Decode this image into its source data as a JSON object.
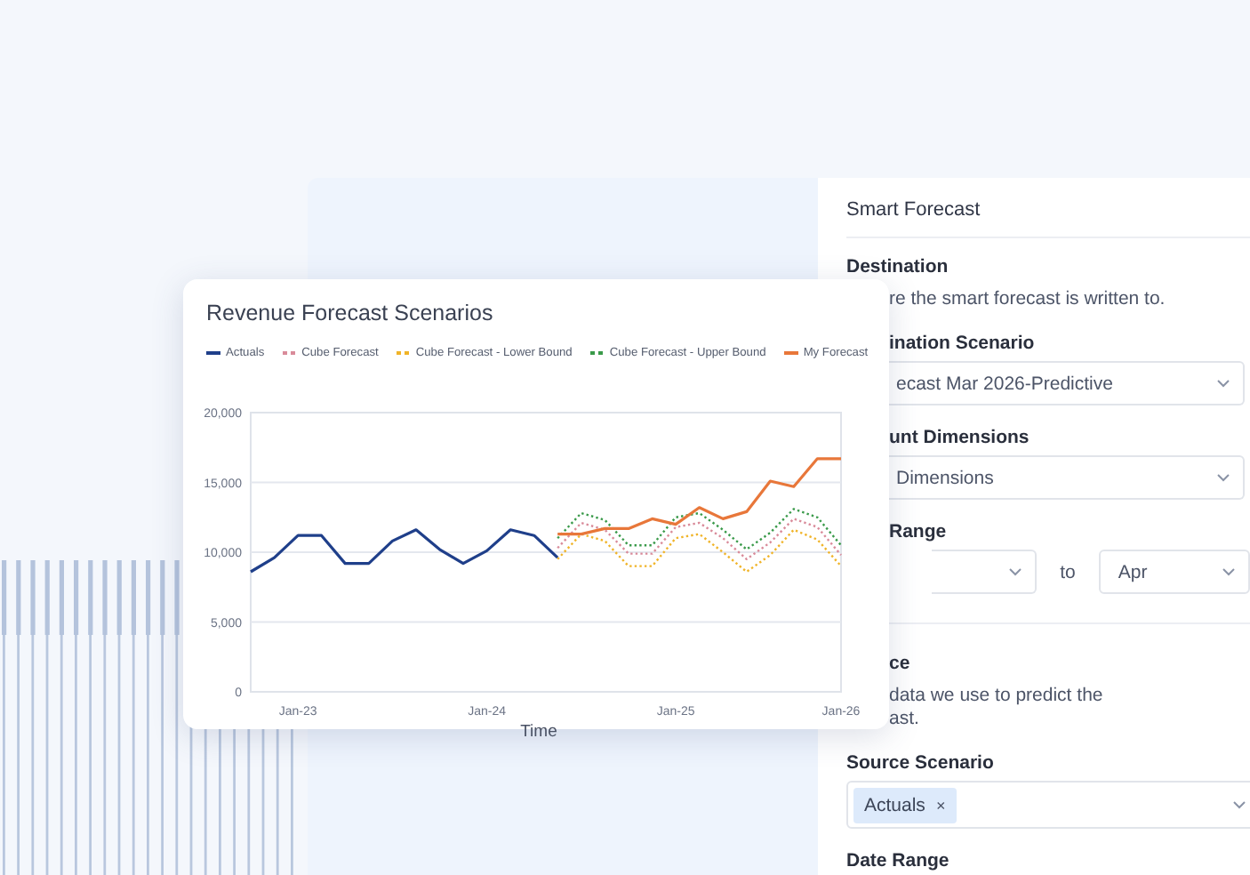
{
  "chart_card": {
    "title": "Revenue Forecast Scenarios",
    "chart_data": {
      "type": "line",
      "xlabel": "Time",
      "categories": [
        null,
        null,
        "Jan-23",
        null,
        null,
        null,
        null,
        null,
        null,
        null,
        "Jan-24",
        null,
        null,
        null,
        null,
        null,
        null,
        null,
        "Jan-25",
        null,
        null,
        null,
        null,
        null,
        null,
        "Jan-26"
      ],
      "ylim": [
        0,
        20000
      ],
      "grid": true,
      "yticks": [
        0,
        {
          "value": 5000,
          "label": "5,000"
        },
        {
          "value": 10000,
          "label": "10,000"
        },
        {
          "value": 15000,
          "label": "15,000"
        },
        {
          "value": 20000,
          "label": "20,000"
        }
      ],
      "series": [
        {
          "name": "Actuals",
          "color": "#1f3f8a",
          "values": [
            8600,
            9600,
            11200,
            11200,
            9200,
            9200,
            10800,
            11600,
            10200,
            9200,
            10100,
            11600,
            11200,
            9600,
            null,
            null,
            null,
            null,
            null,
            null,
            null,
            null,
            null,
            null,
            null,
            null
          ]
        },
        {
          "name": "Cube Forecast",
          "color": "#d98b9a",
          "line_style": "dotted",
          "values": [
            null,
            null,
            null,
            null,
            null,
            null,
            null,
            null,
            null,
            null,
            null,
            null,
            null,
            10300,
            12100,
            11600,
            9900,
            9900,
            11800,
            12100,
            11000,
            9500,
            10700,
            12400,
            11800,
            9800
          ]
        },
        {
          "name": "Cube Forecast - Lower Bound",
          "color": "#f0b429",
          "line_style": "dotted",
          "values": [
            null,
            null,
            null,
            null,
            null,
            null,
            null,
            null,
            null,
            null,
            null,
            null,
            null,
            9500,
            11300,
            10800,
            9000,
            9000,
            11000,
            11300,
            10000,
            8600,
            9800,
            11600,
            10900,
            9000
          ]
        },
        {
          "name": "Cube Forecast - Upper Bound",
          "color": "#3a9a4a",
          "line_style": "dotted",
          "values": [
            null,
            null,
            null,
            null,
            null,
            null,
            null,
            null,
            null,
            null,
            null,
            null,
            null,
            11000,
            12800,
            12300,
            10500,
            10500,
            12500,
            12800,
            11600,
            10200,
            11400,
            13100,
            12500,
            10500
          ]
        },
        {
          "name": "My Forecast",
          "color": "#e8773a",
          "values": [
            null,
            null,
            null,
            null,
            null,
            null,
            null,
            null,
            null,
            null,
            null,
            null,
            null,
            11300,
            11300,
            11700,
            11700,
            12400,
            12000,
            13200,
            12400,
            12900,
            15100,
            14700,
            16700,
            16700
          ]
        }
      ]
    }
  },
  "panel": {
    "title": "Smart Forecast",
    "items": [
      {
        "kind": "heading",
        "text": "Destination",
        "clipped": false
      },
      {
        "kind": "text",
        "text": "re the smart forecast is written to.",
        "clipped": true
      },
      {
        "kind": "label",
        "text": "ination Scenario",
        "clipped": true
      },
      {
        "kind": "select",
        "value": "ecast Mar 2026-Predictive",
        "clipped": true
      },
      {
        "kind": "label",
        "text": "unt Dimensions",
        "clipped": true
      },
      {
        "kind": "select",
        "value": "Dimensions",
        "clipped": true
      },
      {
        "kind": "label",
        "text": "Range",
        "clipped": true
      },
      {
        "kind": "range",
        "joiner": "to",
        "to": "Apr",
        "clipped": true
      },
      {
        "kind": "divider"
      },
      {
        "kind": "heading",
        "text": "ce",
        "clipped": true
      },
      {
        "kind": "text",
        "text": "data we use to predict the",
        "clipped": true
      },
      {
        "kind": "text",
        "text": "ast.",
        "clipped": true
      },
      {
        "kind": "label",
        "text": "Source Scenario",
        "clipped": false
      },
      {
        "kind": "tags",
        "tags": [
          {
            "text": "Actuals",
            "remove": "×"
          }
        ],
        "clipped": false
      },
      {
        "kind": "label",
        "text": "Date Range",
        "clipped": false
      }
    ]
  }
}
